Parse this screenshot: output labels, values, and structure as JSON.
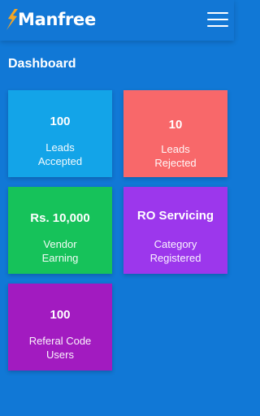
{
  "header": {
    "logo_text": "Manfree",
    "menu_icon": "hamburger-menu-icon"
  },
  "page": {
    "title": "Dashboard"
  },
  "cards": [
    {
      "value": "100",
      "label_line1": "Leads",
      "label_line2": "Accepted",
      "color": "#13a4e8"
    },
    {
      "value": "10",
      "label_line1": "Leads",
      "label_line2": "Rejected",
      "color": "#f8686a"
    },
    {
      "value": "Rs. 10,000",
      "label_line1": "Vendor",
      "label_line2": "Earning",
      "color": "#16c25a"
    },
    {
      "value": "RO Servicing",
      "label_line1": "Category",
      "label_line2": "Registered",
      "color": "#9c37ec"
    },
    {
      "value": "100",
      "label_line1": "Referal Code",
      "label_line2": "Users",
      "color": "#a21bc0"
    }
  ],
  "colors": {
    "background": "#1178d6",
    "topbar": "#1277d5",
    "logo_accent": "#f5a623"
  }
}
